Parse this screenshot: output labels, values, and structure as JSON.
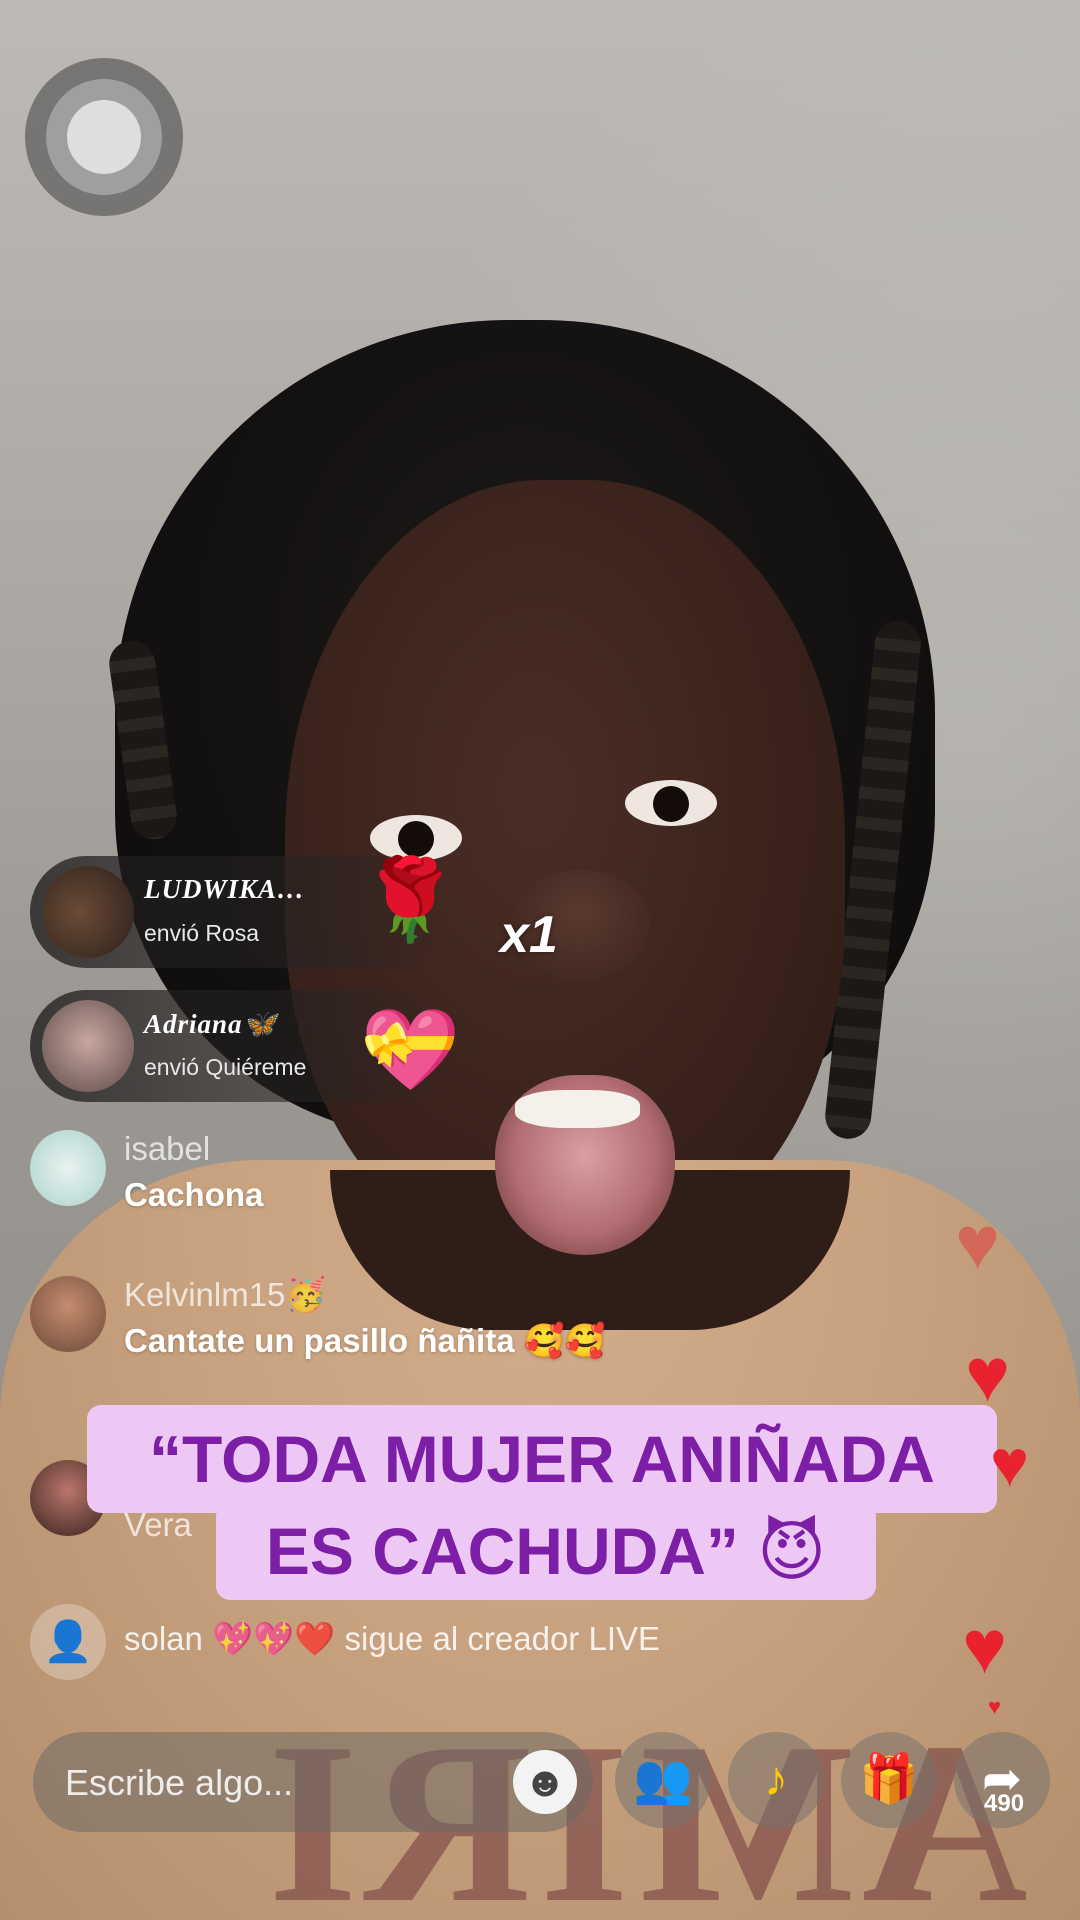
{
  "gifts": [
    {
      "user": "LUDWIKA…",
      "action": "envió Rosa",
      "icon": "🌹"
    },
    {
      "user": "Adriana🦋",
      "action": "envió Quiéreme",
      "icon": "💝"
    }
  ],
  "gift_multiplier": "x1",
  "comments": [
    {
      "user": "isabel",
      "text": "Cachona"
    },
    {
      "user": "Kelvinlm15🥳",
      "text": "Cantate un pasillo ñañita 🥰🥰"
    },
    {
      "user": "Vera",
      "text": ""
    }
  ],
  "follow_notice": "solan 💖💖❤️ sigue al creador LIVE",
  "caption": {
    "line1": "“TODA MUJER ANIÑADA",
    "line2": "ES CACHUDA” 😈"
  },
  "shirt_print": "AMIRI",
  "bottom_bar": {
    "placeholder": "Escribe algo...",
    "emoji_icon": "☻",
    "share_count": "490"
  },
  "colors": {
    "caption_bg": "#eec8f5",
    "caption_text": "#7d1ea6",
    "heart": "#e8232f"
  }
}
